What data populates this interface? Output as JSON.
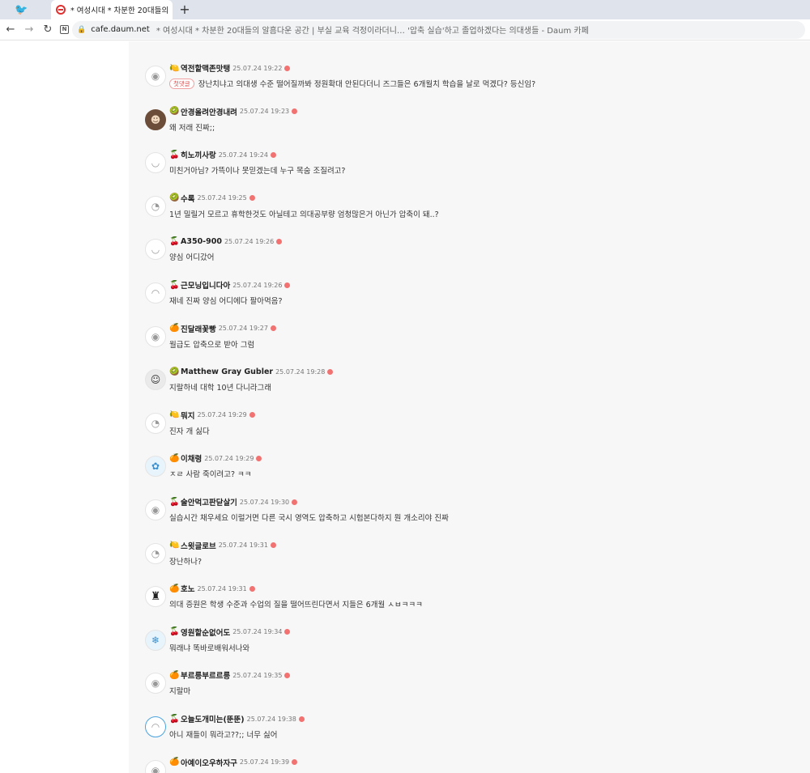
{
  "browser": {
    "tab_title": "* 여성시대 *  차분한 20대들의 알",
    "domain": "cafe.daum.net",
    "page_title": "* 여성시대 *  차분한 20대들의 알흠다운 공간 | 부실 교육 걱정이라더니… '압축 실습'하고 졸업하겠다는 의대생들 - Daum 카페"
  },
  "first_pill": "첫댓글",
  "comments": [
    {
      "level": "🍋",
      "nick": "역전할맥존맛탱",
      "date": "25.07.24 19:22",
      "text": "장난치냐고 의대생 수준 떨어질까봐 정원확대 안된다더니 즈그들은 6개월치 학습을 날로 먹겠다? 등신임?",
      "avatar": "◉"
    },
    {
      "level": "🥝",
      "nick": "안경올려안경내려",
      "date": "25.07.24 19:23",
      "text": "왜 저래 진짜;;",
      "avatar": "☻"
    },
    {
      "level": "🍒",
      "nick": "히노끼사랑",
      "date": "25.07.24 19:24",
      "text": "미친거아님? 가뜩이나 못믿겠는데 누구 목숨 조질려고?",
      "avatar": "◡"
    },
    {
      "level": "🥝",
      "nick": "수록",
      "date": "25.07.24 19:25",
      "text": "1년 밀릴거 모르고 휴학한것도 아닐테고 의대공부량 엄청많은거 아닌가 압축이 돼..?",
      "avatar": "◔"
    },
    {
      "level": "🍒",
      "nick": "A350-900",
      "date": "25.07.24 19:26",
      "text": "양심 어디갔어",
      "avatar": "◡"
    },
    {
      "level": "🍒",
      "nick": "근모닝입니다아",
      "date": "25.07.24 19:26",
      "text": "재네 진짜 양심 어디에다 팔아먹음?",
      "avatar": "◠"
    },
    {
      "level": "🍊",
      "nick": "진달래꽃빵",
      "date": "25.07.24 19:27",
      "text": "월급도 압축으로 받아 그럼",
      "avatar": "◉"
    },
    {
      "level": "🥝",
      "nick": "Matthew Gray Gubler",
      "date": "25.07.24 19:28",
      "text": "지랄하네 대학 10년 다니라그래",
      "avatar": "☺"
    },
    {
      "level": "🍋",
      "nick": "뭐지",
      "date": "25.07.24 19:29",
      "text": "진자 개 싫다",
      "avatar": "◔"
    },
    {
      "level": "🍊",
      "nick": "이채령",
      "date": "25.07.24 19:29",
      "text": "ㅈㄹ 사람 죽이려고? ㅋㅋ",
      "avatar": "✿"
    },
    {
      "level": "🍒",
      "nick": "술안먹고판닫살기",
      "date": "25.07.24 19:30",
      "text": "실습시간 채우세요 이럴거면 다른 국시 영역도 압축하고 시험본다하지 뭔 개소리야 진짜",
      "avatar": "◉"
    },
    {
      "level": "🍋",
      "nick": "스윗글로브",
      "date": "25.07.24 19:31",
      "text": "장난하나?",
      "avatar": "◔"
    },
    {
      "level": "🍊",
      "nick": "호노",
      "date": "25.07.24 19:31",
      "text": "의대 증원은 학생 수준과 수업의 질을 떨어뜨린다면서 지들은 6개월 ㅅㅂㅋㅋㅋ",
      "avatar": "♜"
    },
    {
      "level": "🍒",
      "nick": "영원할순없어도",
      "date": "25.07.24 19:34",
      "text": "뭐래냐 똑바로배워서나와",
      "avatar": "❄"
    },
    {
      "level": "🍊",
      "nick": "부르릉부르르릉",
      "date": "25.07.24 19:35",
      "text": "지랄마",
      "avatar": "◉"
    },
    {
      "level": "🍒",
      "nick": "오늘도개미는(뚠뚠)",
      "date": "25.07.24 19:38",
      "text": "아니 재들이 뭐라고??;; 너무 싫어",
      "avatar": "◠"
    },
    {
      "level": "🍊",
      "nick": "아예이오우하자구",
      "date": "25.07.24 19:39",
      "text": "",
      "avatar": "◉"
    }
  ]
}
